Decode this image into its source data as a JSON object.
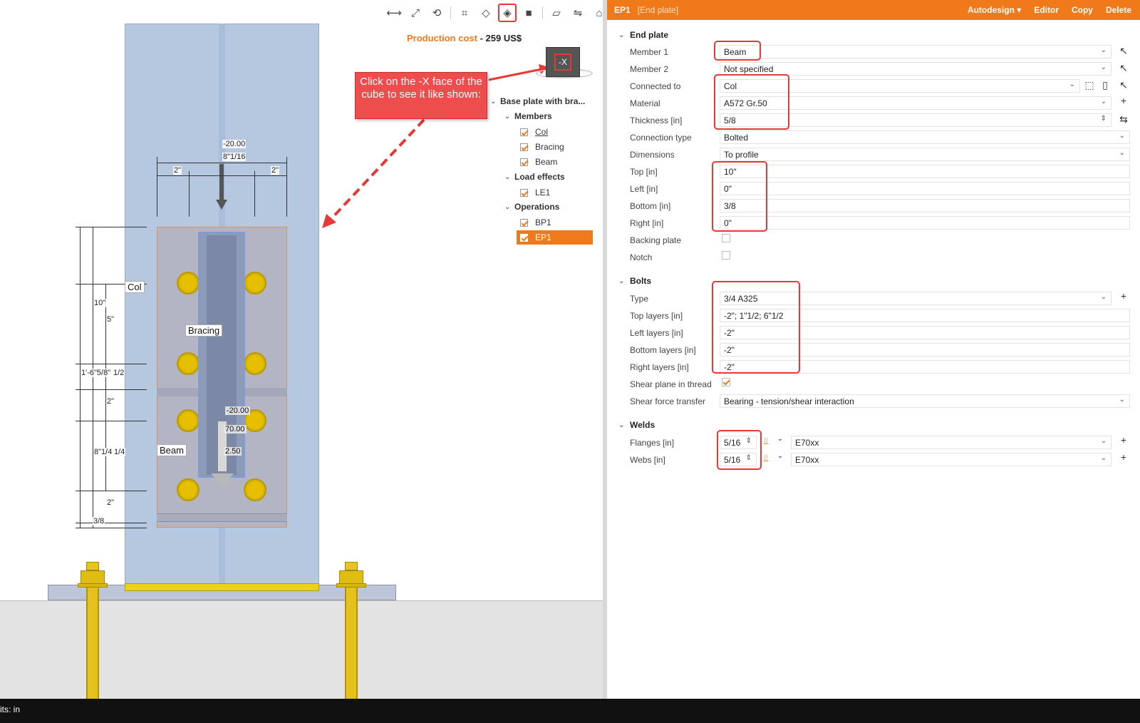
{
  "toolbar": {
    "icons": [
      "measure-icon",
      "fit-view-icon",
      "rotate-icon",
      "crop-icon",
      "wireframe-icon",
      "transparent-view-icon",
      "solid-view-icon",
      "section-icon",
      "mirror-icon",
      "home-icon"
    ]
  },
  "production_cost": {
    "label": "Production cost",
    "dash": " - ",
    "value": "259 US$"
  },
  "navcube": {
    "face": "-X"
  },
  "callout": {
    "text": "Click on the -X  face of the cube to see it like shown:"
  },
  "tree": {
    "root": "Base plate with bra...",
    "members_label": "Members",
    "members": [
      "Col",
      "Bracing",
      "Beam"
    ],
    "load_effects_label": "Load effects",
    "load_effects": [
      "LE1"
    ],
    "operations_label": "Operations",
    "operations": [
      "BP1",
      "EP1"
    ]
  },
  "drawing": {
    "top_force": "-20.00",
    "top_width": "8\"1/16",
    "left_edge": "2\"",
    "right_edge": "2\"",
    "col_label": "Col",
    "bracing_label": "Bracing",
    "beam_label": "Beam",
    "dim_10": "10\"",
    "dim_5": "5\"",
    "dim_total": "1'-6\"5/8\"",
    "dim_half": "1/2",
    "dim_2a": "2\"",
    "dim_8": "8\"1/4",
    "dim_quarter": "1/4",
    "dim_2b": "2\"",
    "dim_38": "3/8",
    "force_1": "-20.00",
    "force_2": "70.00",
    "force_3": "2.50"
  },
  "statusbar": {
    "text": "its: in"
  },
  "panel": {
    "header": {
      "id": "EP1",
      "type": "[End plate]",
      "autodesign": "Autodesign ▾",
      "editor": "Editor",
      "copy": "Copy",
      "delete": "Delete"
    },
    "sections": {
      "end_plate": "End plate",
      "bolts": "Bolts",
      "welds": "Welds"
    },
    "end_plate": {
      "member1_label": "Member 1",
      "member1": "Beam",
      "member2_label": "Member 2",
      "member2": "Not specified",
      "connected_label": "Connected to",
      "connected": "Col",
      "material_label": "Material",
      "material": "A572 Gr.50",
      "thickness_label": "Thickness [in]",
      "thickness": "5/8",
      "conn_type_label": "Connection type",
      "conn_type": "Bolted",
      "dimensions_label": "Dimensions",
      "dimensions": "To profile",
      "top_label": "Top [in]",
      "top": "10\"",
      "left_label": "Left [in]",
      "left": "0\"",
      "bottom_label": "Bottom [in]",
      "bottom": "3/8",
      "right_label": "Right [in]",
      "right": "0\"",
      "backing_label": "Backing plate",
      "notch_label": "Notch"
    },
    "bolts": {
      "type_label": "Type",
      "type": "3/4 A325",
      "top_layers_label": "Top layers [in]",
      "top_layers": "-2\"; 1\"1/2; 6\"1/2",
      "left_layers_label": "Left layers [in]",
      "left_layers": "-2\"",
      "bottom_layers_label": "Bottom layers [in]",
      "bottom_layers": "-2\"",
      "right_layers_label": "Right layers [in]",
      "right_layers": "-2\"",
      "shear_plane_label": "Shear plane in thread",
      "shear_force_label": "Shear force transfer",
      "shear_force": "Bearing - tension/shear interaction"
    },
    "welds": {
      "flanges_label": "Flanges [in]",
      "flanges": "5/16",
      "flanges_type": "E70xx",
      "webs_label": "Webs [in]",
      "webs": "5/16",
      "webs_type": "E70xx"
    }
  }
}
